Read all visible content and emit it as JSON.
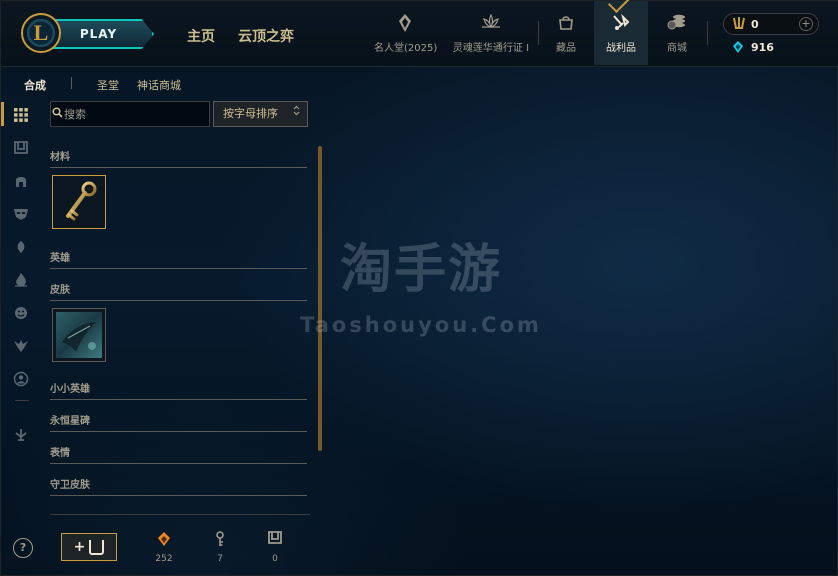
{
  "brand": {
    "logo_letter": "L",
    "play_label": "PLAY"
  },
  "top_links": [
    "主页",
    "云顶之弈"
  ],
  "nav": {
    "hall_of_legends": "名人堂(2025)",
    "event_pass": "灵魂莲华通行证 I",
    "collection": "藏品",
    "loot": "战利品",
    "store": "商城"
  },
  "wallet": {
    "rp": "0",
    "blue_essence": "916"
  },
  "sub_tabs": [
    "合成",
    "圣堂",
    "神话商城"
  ],
  "search": {
    "placeholder": "搜索"
  },
  "sort": {
    "label": "按字母排序",
    "arrow": "⌃⌄"
  },
  "sections": {
    "materials": "材料",
    "champions": "英雄",
    "skins": "皮肤",
    "little_legends": "小小英雄",
    "eternals": "永恒星碑",
    "emotes": "表情",
    "ward_skins": "守卫皮肤"
  },
  "icons": {
    "rail": [
      "grid-icon",
      "chest-icon",
      "helmet-icon",
      "mask-icon",
      "wisp-icon",
      "flame-icon",
      "emote-icon",
      "ward-icon",
      "profile-icon",
      "sword-icon"
    ]
  },
  "bottom": {
    "help": "?",
    "add_plus": "+",
    "orange_essence": "252",
    "keys": "7",
    "chests": "0"
  },
  "watermark": {
    "title": "淘手游",
    "subtitle": "Taoshouyou.Com"
  },
  "colors": {
    "gold": "#c89b3c",
    "teal": "#0ac8b9",
    "blue_essence": "#0acbe6",
    "orange_essence": "#e9862c"
  }
}
